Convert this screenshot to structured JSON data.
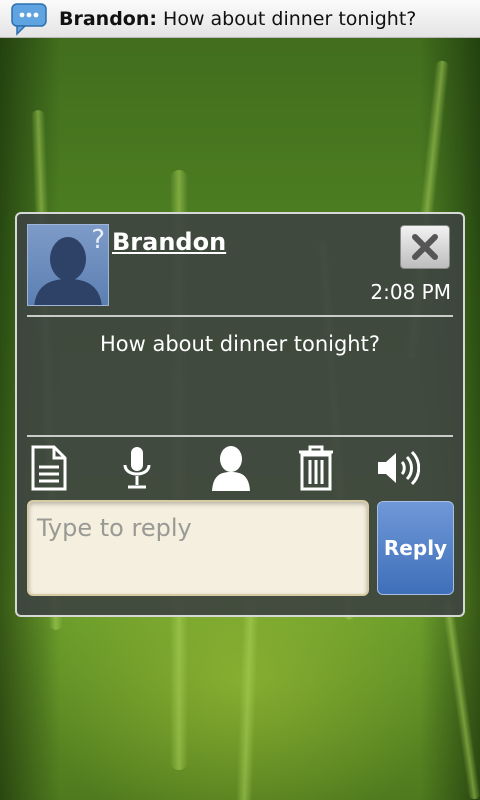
{
  "status_bar": {
    "sender": "Brandon:",
    "message": "How about dinner tonight?",
    "icon": "sms-notification-icon"
  },
  "popup": {
    "contact_name": "Brandon",
    "avatar_badge": "?",
    "time": "2:08 PM",
    "message": "How about dinner tonight?",
    "actions": [
      {
        "icon": "document-icon"
      },
      {
        "icon": "microphone-icon"
      },
      {
        "icon": "contact-icon"
      },
      {
        "icon": "trash-icon"
      },
      {
        "icon": "speaker-icon"
      }
    ],
    "reply": {
      "placeholder": "Type to reply",
      "button_label": "Reply"
    }
  },
  "colors": {
    "accent": "#4a7cc6",
    "popup_bg": "#3e4440",
    "input_bg": "#f4efdf"
  }
}
